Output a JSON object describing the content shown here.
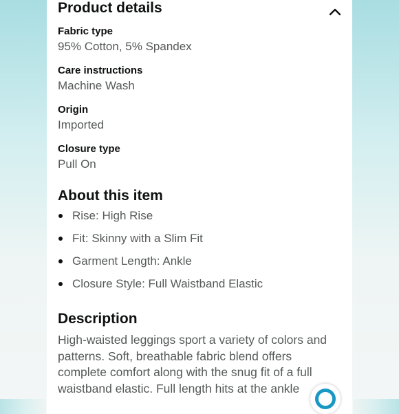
{
  "product_details": {
    "title": "Product details",
    "collapse_icon": "chevron-up-icon",
    "rows": [
      {
        "label": "Fabric type",
        "value": "95% Cotton, 5% Spandex"
      },
      {
        "label": "Care instructions",
        "value": "Machine Wash"
      },
      {
        "label": "Origin",
        "value": "Imported"
      },
      {
        "label": "Closure type",
        "value": "Pull On"
      }
    ]
  },
  "about": {
    "title": "About this item",
    "bullets": [
      "Rise: High Rise",
      "Fit: Skinny with a Slim Fit",
      "Garment Length: Ankle",
      "Closure Style: Full Waistband Elastic"
    ]
  },
  "description": {
    "title": "Description",
    "text": "High-waisted leggings sport a variety of colors and patterns. Soft, breathable fabric blend offers complete comfort along with the snug fit of a full waistband elastic. Full length hits at the ankle"
  },
  "floating_button": {
    "icon": "ring-icon"
  },
  "colors": {
    "heading": "#0f1111",
    "body_text": "#565959",
    "background_accent": "#a8dde2",
    "button_accent": "#1a98c4"
  }
}
